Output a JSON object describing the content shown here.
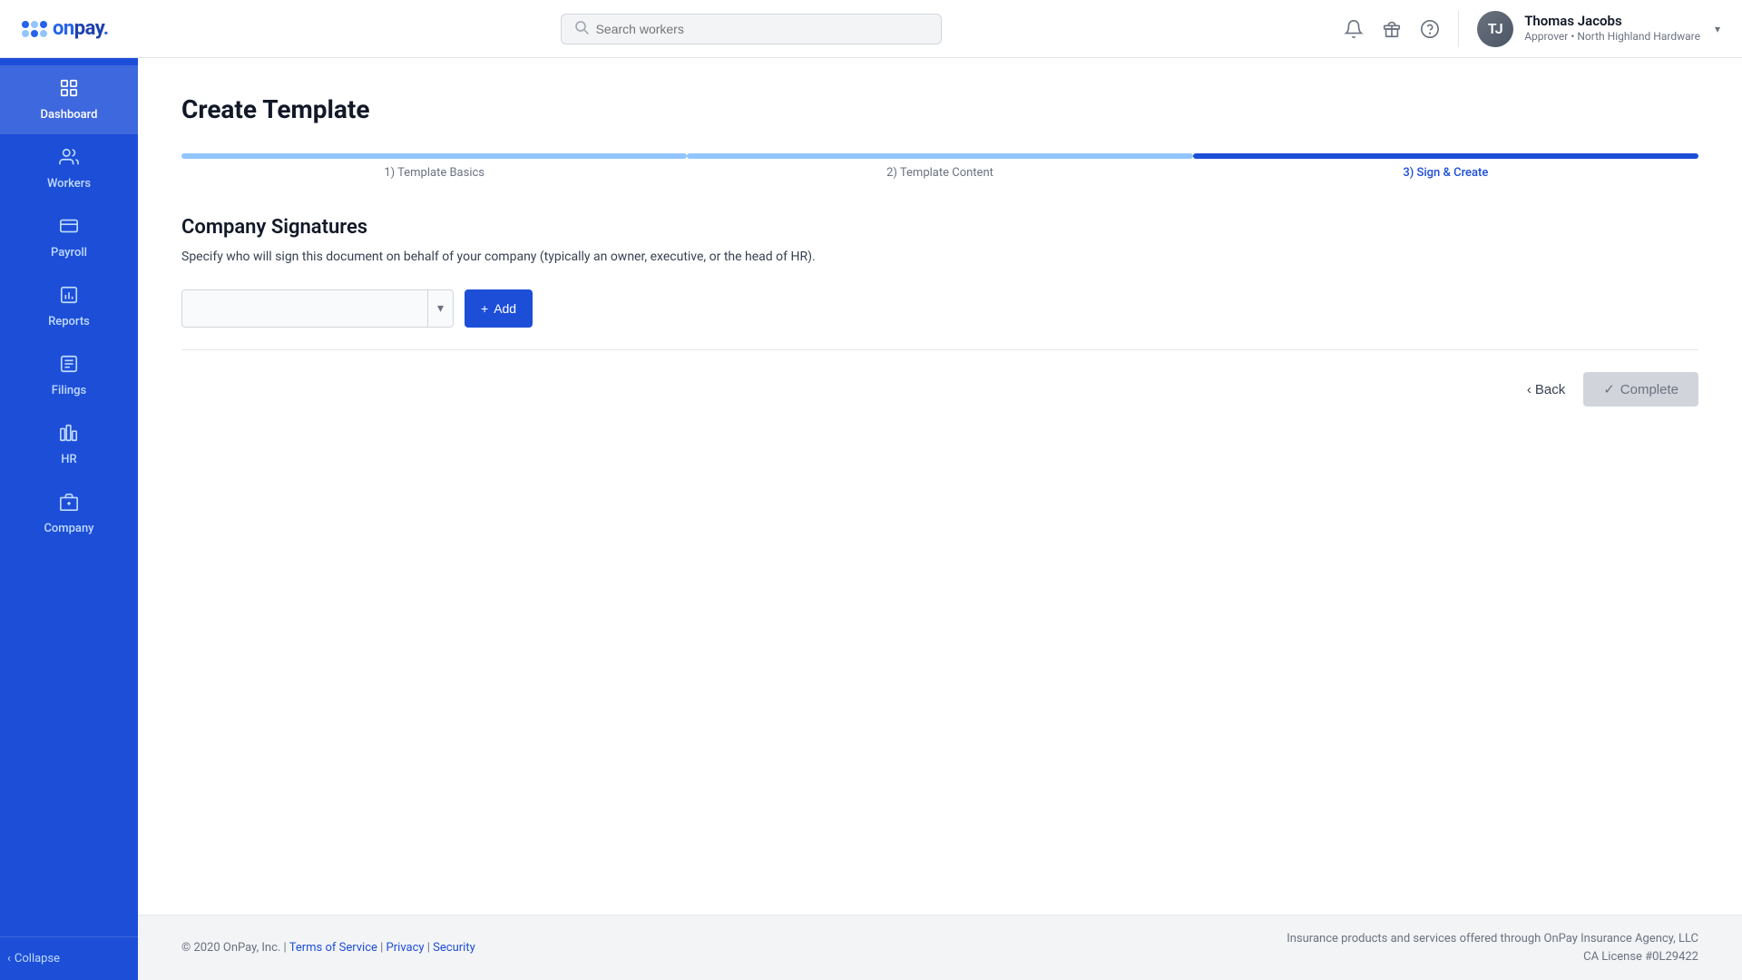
{
  "header": {
    "logo_text": "onpay",
    "search_placeholder": "Search workers",
    "user_name": "Thomas Jacobs",
    "user_role": "Approver",
    "user_company": "North Highland Hardware",
    "user_role_full": "Approver • North Highland Hardware"
  },
  "sidebar": {
    "items": [
      {
        "id": "dashboard",
        "label": "Dashboard",
        "icon": "⊞"
      },
      {
        "id": "workers",
        "label": "Workers",
        "icon": "👤"
      },
      {
        "id": "payroll",
        "label": "Payroll",
        "icon": "💳"
      },
      {
        "id": "reports",
        "label": "Reports",
        "icon": "📊"
      },
      {
        "id": "filings",
        "label": "Filings",
        "icon": "📋"
      },
      {
        "id": "hr",
        "label": "HR",
        "icon": "🏢"
      },
      {
        "id": "company",
        "label": "Company",
        "icon": "🏬"
      }
    ],
    "collapse_label": "Collapse"
  },
  "page": {
    "title": "Create Template",
    "steps": [
      {
        "id": "step1",
        "label": "1) Template Basics",
        "state": "completed"
      },
      {
        "id": "step2",
        "label": "2) Template Content",
        "state": "completed"
      },
      {
        "id": "step3",
        "label": "3) Sign & Create",
        "state": "active"
      }
    ],
    "section_title": "Company Signatures",
    "section_desc": "Specify who will sign this document on behalf of your company (typically an owner, executive, or the head of HR).",
    "add_button_label": "+ Add",
    "back_button_label": "‹ Back",
    "complete_button_label": "Complete",
    "complete_icon": "✓",
    "select_placeholder": ""
  },
  "footer": {
    "copyright": "© 2020 OnPay, Inc. |",
    "terms_label": "Terms of Service",
    "privacy_label": "Privacy",
    "security_label": "Security",
    "insurance_line1": "Insurance products and services offered through OnPay Insurance Agency, LLC",
    "insurance_line2": "CA License #0L29422"
  }
}
